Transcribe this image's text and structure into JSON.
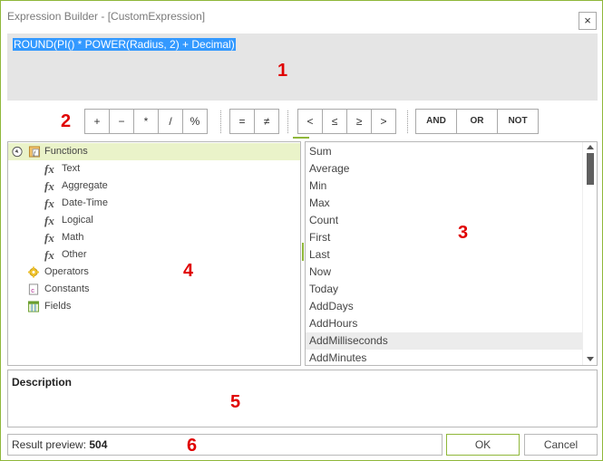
{
  "window": {
    "title": "Expression Builder - [CustomExpression]",
    "close_glyph": "×"
  },
  "editor": {
    "expression": "ROUND(PI() * POWER(Radius, 2) + Decimal)"
  },
  "callouts": [
    "1",
    "2",
    "3",
    "4",
    "5",
    "6"
  ],
  "operators": {
    "arithmetic": [
      "+",
      "−",
      "*",
      "/",
      "%"
    ],
    "equality": [
      "=",
      "≠"
    ],
    "comparison": [
      "<",
      "≤",
      "≥",
      ">"
    ],
    "logical": [
      "AND",
      "OR",
      "NOT"
    ]
  },
  "tree": {
    "root": "Functions",
    "children": [
      "Text",
      "Aggregate",
      "Date-Time",
      "Logical",
      "Math",
      "Other"
    ],
    "operators": "Operators",
    "constants": "Constants",
    "fields": "Fields"
  },
  "functions_list": [
    "Sum",
    "Average",
    "Min",
    "Max",
    "Count",
    "First",
    "Last",
    "Now",
    "Today",
    "AddDays",
    "AddHours",
    "AddMilliseconds",
    "AddMinutes"
  ],
  "description": {
    "title": "Description"
  },
  "result": {
    "label": "Result preview:",
    "value": "504"
  },
  "buttons": {
    "ok": "OK",
    "cancel": "Cancel"
  },
  "colors": {
    "accent": "#8fb73a",
    "selection": "#3399ff",
    "callout": "#e00000"
  }
}
